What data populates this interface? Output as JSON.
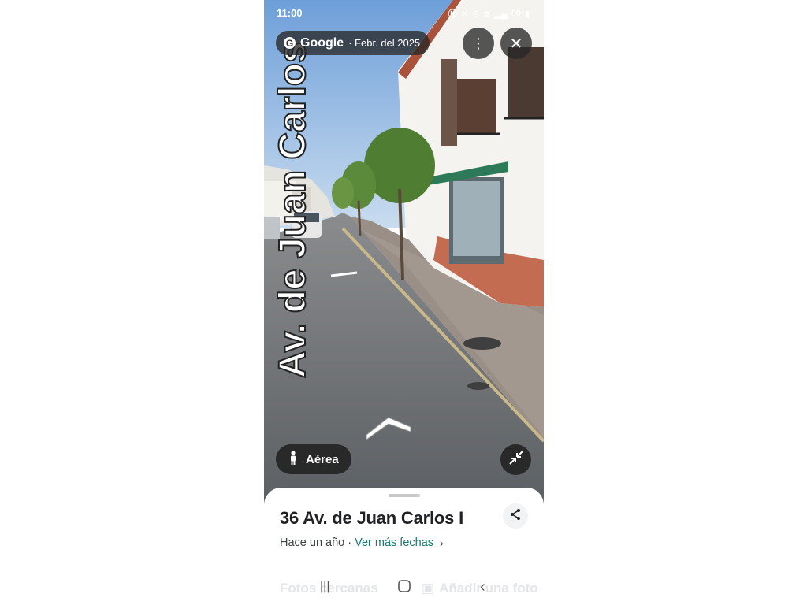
{
  "status": {
    "time": "11:00",
    "icons": [
      "nfc-icon",
      "mute-icon",
      "location-icon",
      "wifi-icon",
      "signal-icon"
    ],
    "battery": "80"
  },
  "viewer": {
    "brand": "Google",
    "date": "· Febr. del 2025",
    "street_label": "Av. de Juan Carlos",
    "aerial_label": "Aérea"
  },
  "sheet": {
    "address": "36 Av. de Juan Carlos I",
    "age": "Hace un año ·",
    "more_dates": "Ver más fechas",
    "nearby_label": "Fotos cercanas",
    "add_photo_label": "Añadir una foto"
  },
  "colors": {
    "link": "#137a6f",
    "pill_bg": "#282828",
    "sky": "#8fb6e4",
    "road": "#6b6e72"
  }
}
